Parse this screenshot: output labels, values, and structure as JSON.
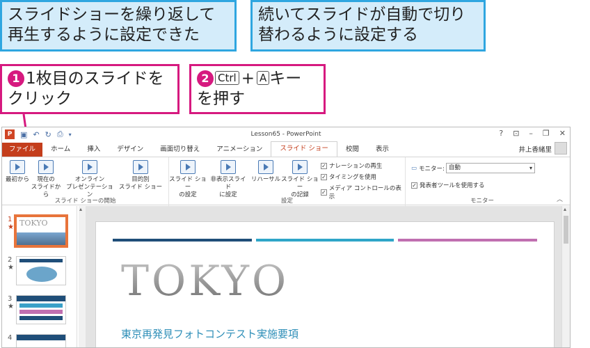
{
  "callouts": {
    "top_left": [
      "スライドショーを繰り返して",
      "再生するように設定できた"
    ],
    "top_right": [
      "続いてスライドが自動で切り",
      "替わるように設定する"
    ],
    "step1_num": "❶",
    "step1": [
      "1枚目のスライドを",
      "クリック"
    ],
    "step2_num": "❷",
    "step2_key1": "Ctrl",
    "step2_plus": "+",
    "step2_key2": "A",
    "step2_tail": "キー",
    "step2_line2": "を押す"
  },
  "window": {
    "title": "Lesson65 - PowerPoint",
    "logo": "P",
    "help": "?",
    "controls": [
      "⊡",
      "–",
      "❐",
      "✕"
    ]
  },
  "tabs": [
    "ファイル",
    "ホーム",
    "挿入",
    "デザイン",
    "画面切り替え",
    "アニメーション",
    "スライド ショー",
    "校閲",
    "表示"
  ],
  "user_name": "井上香緒里",
  "ribbon": {
    "start_group": {
      "label": "スライド ショーの開始",
      "buttons": [
        [
          "最初から"
        ],
        [
          "現在の",
          "スライドから"
        ],
        [
          "オンライン",
          "プレゼンテーション"
        ],
        [
          "目的別",
          "スライド ショー"
        ]
      ]
    },
    "setup_group": {
      "label": "設定",
      "buttons": [
        [
          "スライド ショー",
          "の設定"
        ],
        [
          "非表示スライド",
          "に設定"
        ],
        [
          "リハーサル"
        ],
        [
          "スライド ショー",
          "の記録"
        ]
      ],
      "checks": [
        "ナレーションの再生",
        "タイミングを使用",
        "メディア コントロールの表示"
      ]
    },
    "monitor_group": {
      "label": "モニター",
      "monitor_label": "モニター:",
      "monitor_value": "自動",
      "presenter_check": "発表者ツールを使用する"
    }
  },
  "thumbnails": [
    {
      "num": "1",
      "title": "TOKYO"
    },
    {
      "num": "2"
    },
    {
      "num": "3"
    },
    {
      "num": "4"
    }
  ],
  "slide": {
    "title": "TOKYO",
    "subtitle": "東京再発見フォトコンテスト実施要項"
  },
  "colors": {
    "accent_magenta": "#d6197f",
    "accent_blue": "#2fa6e0",
    "ppt_red": "#c43e1c",
    "bar1": "#1f4e79",
    "bar2": "#2fa6c8",
    "bar3": "#c06fb0"
  }
}
